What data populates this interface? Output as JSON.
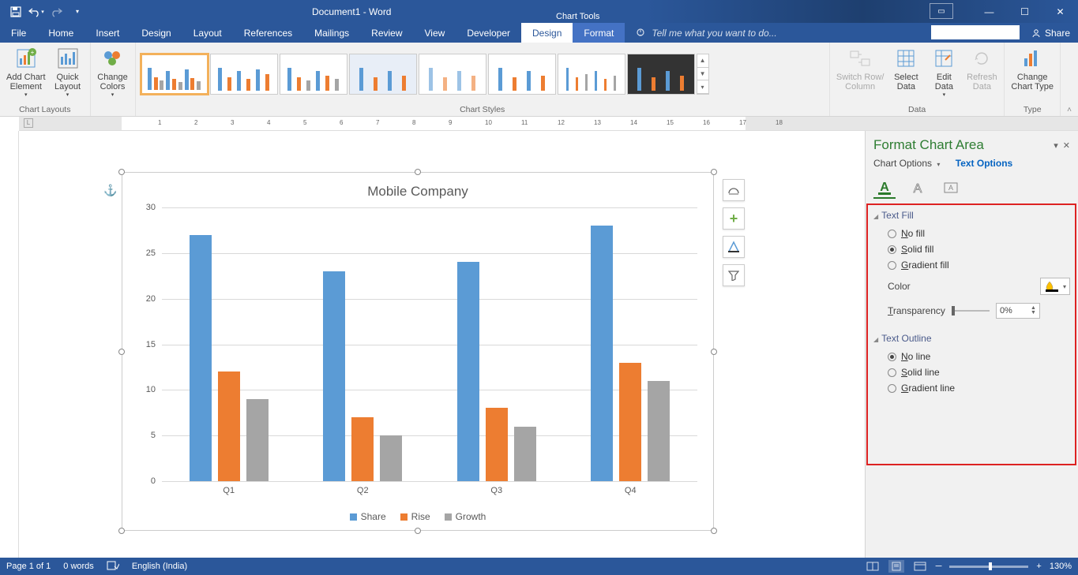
{
  "title": "Document1 - Word",
  "chart_tools_label": "Chart Tools",
  "tabs": [
    "File",
    "Home",
    "Insert",
    "Design",
    "Layout",
    "References",
    "Mailings",
    "Review",
    "View",
    "Developer",
    "Design",
    "Format"
  ],
  "active_tab_index": 10,
  "tell_me": "Tell me what you want to do...",
  "share_label": "Share",
  "ribbon_groups": {
    "chart_layouts": {
      "label": "Chart Layouts",
      "add_chart_element": "Add Chart\nElement",
      "quick_layout": "Quick\nLayout"
    },
    "change_colors": "Change\nColors",
    "chart_styles": {
      "label": "Chart Styles"
    },
    "data": {
      "label": "Data",
      "switch": "Switch Row/\nColumn",
      "select": "Select\nData",
      "edit": "Edit\nData",
      "refresh": "Refresh\nData"
    },
    "type": {
      "label": "Type",
      "change": "Change\nChart Type"
    }
  },
  "chart_data": {
    "type": "bar",
    "title": "Mobile Company",
    "categories": [
      "Q1",
      "Q2",
      "Q3",
      "Q4"
    ],
    "series": [
      {
        "name": "Share",
        "color": "#5b9bd5",
        "values": [
          27,
          23,
          24,
          28
        ]
      },
      {
        "name": "Rise",
        "color": "#ed7d31",
        "values": [
          12,
          7,
          8,
          13
        ]
      },
      {
        "name": "Growth",
        "color": "#a5a5a5",
        "values": [
          9,
          5,
          6,
          11
        ]
      }
    ],
    "ylim": [
      0,
      30
    ],
    "yticks": [
      0,
      5,
      10,
      15,
      20,
      25,
      30
    ],
    "xlabel": "",
    "ylabel": ""
  },
  "format_pane": {
    "title": "Format Chart Area",
    "chart_options": "Chart Options",
    "text_options": "Text Options",
    "sections": {
      "text_fill": {
        "label": "Text Fill",
        "options": [
          "No fill",
          "Solid fill",
          "Gradient fill"
        ],
        "selected": 1,
        "color_label": "Color",
        "transparency_label": "Transparency",
        "transparency_value": "0%"
      },
      "text_outline": {
        "label": "Text Outline",
        "options": [
          "No line",
          "Solid line",
          "Gradient line"
        ],
        "selected": 0
      }
    }
  },
  "status_bar": {
    "page": "Page 1 of 1",
    "words": "0 words",
    "lang": "English (India)",
    "zoom": "130%"
  }
}
